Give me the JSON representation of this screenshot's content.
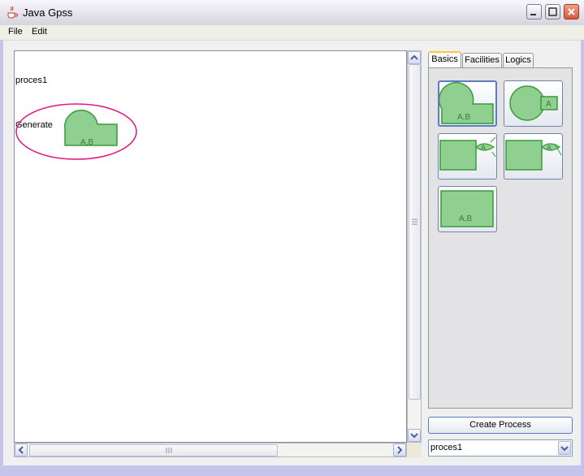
{
  "window": {
    "title": "Java Gpss"
  },
  "menu": {
    "file": "File",
    "edit": "Edit"
  },
  "canvas": {
    "process_label": "proces1",
    "block_label": "Generate",
    "block_params": "A,B"
  },
  "palette": {
    "tabs": [
      "Basics",
      "Facilities",
      "Logics"
    ],
    "active_tab": "Basics",
    "buttons": {
      "generate_params": "A,B",
      "terminate_param": "A",
      "queue_param": "A",
      "depart_param": "A",
      "advance_params": "A,B"
    }
  },
  "create_process_label": "Create Process",
  "process_select": {
    "value": "proces1"
  },
  "colors": {
    "block_fill": "#8fcf8f",
    "block_stroke": "#3a9a3a",
    "highlight": "#e0177f"
  }
}
